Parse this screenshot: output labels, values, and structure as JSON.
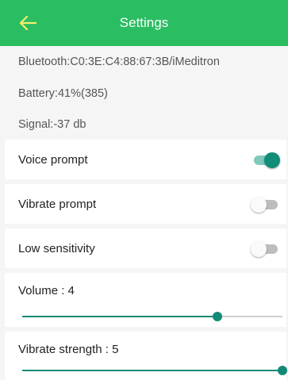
{
  "app_bar": {
    "title": "Settings",
    "back_icon": "arrow-left-icon",
    "background_color": "#2bbd62",
    "back_icon_color": "#f3ef6a"
  },
  "info": {
    "bluetooth": "Bluetooth:C0:3E:C4:88:67:3B/iMeditron",
    "battery": "Battery:41%(385)",
    "signal": "Signal:-37 db"
  },
  "toggles": [
    {
      "label": "Voice prompt",
      "on": true
    },
    {
      "label": "Vibrate prompt",
      "on": false
    },
    {
      "label": "Low sensitivity",
      "on": false
    }
  ],
  "sliders": {
    "volume": {
      "label": "Volume : 4",
      "fraction": 0.75
    },
    "vibrate_strength": {
      "label": "Vibrate strength : 5",
      "fraction": 1.0
    }
  },
  "colors": {
    "accent": "#148a76",
    "switch_on_thumb": "#128d78",
    "switch_on_track": "#7fc9bd"
  }
}
